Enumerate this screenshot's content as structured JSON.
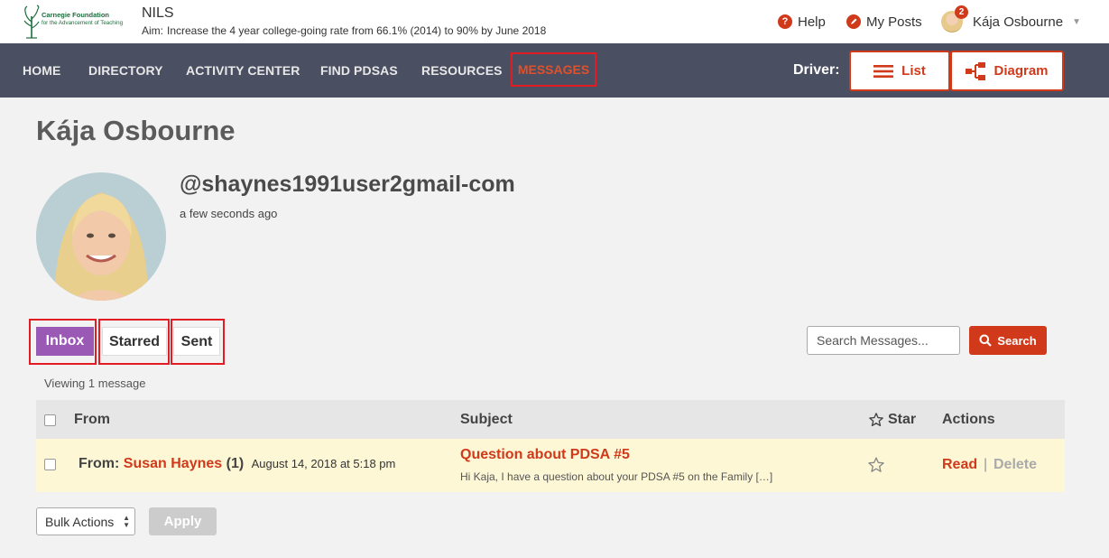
{
  "header": {
    "logo_line1": "Carnegie Foundation",
    "logo_line2": "for the Advancement of Teaching",
    "app_name": "NILS",
    "aim_label": "Aim:",
    "aim_text": "Increase the 4 year college-going rate from 66.1% (2014) to 90% by June 2018",
    "help_icon": "?",
    "help_label": "Help",
    "my_posts_label": "My Posts",
    "user_name": "Kája Osbourne",
    "notification_count": "2"
  },
  "nav": {
    "items": [
      "HOME",
      "DIRECTORY",
      "ACTIVITY CENTER",
      "FIND PDSAS",
      "RESOURCES",
      "MESSAGES"
    ],
    "active": "MESSAGES",
    "driver_label": "Driver:",
    "driver_list_label": "List",
    "driver_diagram_label": "Diagram"
  },
  "profile": {
    "name": "Kája Osbourne",
    "handle": "@shaynes1991user2gmail-com",
    "last_active": "a few seconds ago"
  },
  "tabs": {
    "inbox": "Inbox",
    "starred": "Starred",
    "sent": "Sent"
  },
  "search": {
    "placeholder": "Search Messages...",
    "button_label": "Search"
  },
  "messages": {
    "viewing_text": "Viewing 1 message",
    "columns": {
      "from": "From",
      "subject": "Subject",
      "star": "Star",
      "actions": "Actions"
    },
    "rows": [
      {
        "from_prefix": "From:",
        "sender": "Susan Haynes",
        "count": "(1)",
        "date": "August 14, 2018 at 5:18 pm",
        "subject": "Question about PDSA #5",
        "preview": "Hi Kaja, I have a question about your PDSA #5 on the Family […]",
        "read_label": "Read",
        "separator": "|",
        "delete_label": "Delete"
      }
    ]
  },
  "bulk": {
    "select_label": "Bulk Actions",
    "apply_label": "Apply"
  },
  "colors": {
    "accent": "#d0391a",
    "nav_bg": "#4a4f61",
    "inbox_tab": "#9b59b6",
    "row_highlight": "#fdf7d6",
    "annotation_box": "#e31b23"
  }
}
